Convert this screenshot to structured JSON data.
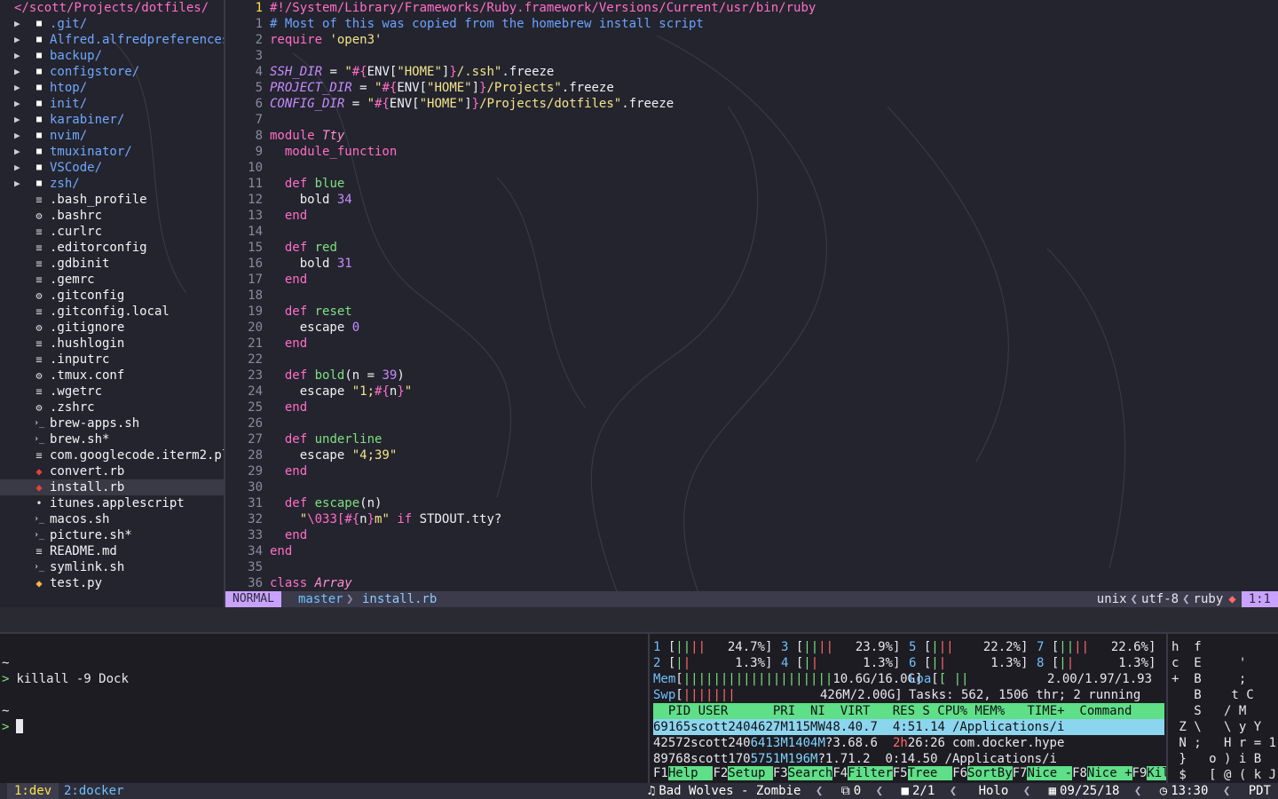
{
  "nerdtree": {
    "root": "</scott/Projects/dotfiles/",
    "items": [
      {
        "name": ".git/",
        "kind": "dir",
        "icon": "folder-icon"
      },
      {
        "name": "Alfred.alfredpreferences",
        "kind": "dir",
        "icon": "folder-icon"
      },
      {
        "name": "backup/",
        "kind": "dir",
        "icon": "folder-icon"
      },
      {
        "name": "configstore/",
        "kind": "dir",
        "icon": "folder-icon"
      },
      {
        "name": "htop/",
        "kind": "dir",
        "icon": "folder-icon"
      },
      {
        "name": "init/",
        "kind": "dir",
        "icon": "folder-icon"
      },
      {
        "name": "karabiner/",
        "kind": "dir",
        "icon": "folder-icon"
      },
      {
        "name": "nvim/",
        "kind": "dir",
        "icon": "folder-icon"
      },
      {
        "name": "tmuxinator/",
        "kind": "dir",
        "icon": "folder-icon"
      },
      {
        "name": "VSCode/",
        "kind": "dir",
        "icon": "folder-icon"
      },
      {
        "name": "zsh/",
        "kind": "dir",
        "icon": "folder-icon"
      },
      {
        "name": ".bash_profile",
        "kind": "file",
        "icon": "text-file-icon"
      },
      {
        "name": ".bashrc",
        "kind": "file",
        "icon": "gear-icon"
      },
      {
        "name": ".curlrc",
        "kind": "file",
        "icon": "text-file-icon"
      },
      {
        "name": ".editorconfig",
        "kind": "file",
        "icon": "text-file-icon"
      },
      {
        "name": ".gdbinit",
        "kind": "file",
        "icon": "text-file-icon"
      },
      {
        "name": ".gemrc",
        "kind": "file",
        "icon": "text-file-icon"
      },
      {
        "name": ".gitconfig",
        "kind": "file",
        "icon": "gear-icon"
      },
      {
        "name": ".gitconfig.local",
        "kind": "file",
        "icon": "text-file-icon"
      },
      {
        "name": ".gitignore",
        "kind": "file",
        "icon": "gear-icon"
      },
      {
        "name": ".hushlogin",
        "kind": "file",
        "icon": "text-file-icon"
      },
      {
        "name": ".inputrc",
        "kind": "file",
        "icon": "text-file-icon"
      },
      {
        "name": ".tmux.conf",
        "kind": "file",
        "icon": "gear-icon"
      },
      {
        "name": ".wgetrc",
        "kind": "file",
        "icon": "text-file-icon"
      },
      {
        "name": ".zshrc",
        "kind": "file",
        "icon": "gear-icon"
      },
      {
        "name": "brew-apps.sh",
        "kind": "file",
        "icon": "shell-icon"
      },
      {
        "name": "brew.sh*",
        "kind": "file",
        "icon": "shell-icon"
      },
      {
        "name": "com.googlecode.iterm2.pl",
        "kind": "file",
        "icon": "text-file-icon"
      },
      {
        "name": "convert.rb",
        "kind": "file",
        "icon": "ruby-icon"
      },
      {
        "name": "install.rb",
        "kind": "file",
        "icon": "ruby-icon",
        "selected": true
      },
      {
        "name": "itunes.applescript",
        "kind": "file",
        "icon": "apple-icon"
      },
      {
        "name": "macos.sh",
        "kind": "file",
        "icon": "shell-icon"
      },
      {
        "name": "picture.sh*",
        "kind": "file",
        "icon": "shell-icon"
      },
      {
        "name": "README.md",
        "kind": "file",
        "icon": "text-file-icon"
      },
      {
        "name": "symlink.sh",
        "kind": "file",
        "icon": "shell-icon"
      },
      {
        "name": "test.py",
        "kind": "file",
        "icon": "python-icon"
      }
    ]
  },
  "editor": {
    "current_line": "1",
    "lines": [
      {
        "n": "",
        "t": [
          [
            "sh",
            "#!/System/Library/Frameworks/Ruby.framework/Versions/Current/usr/bin/ruby"
          ]
        ]
      },
      {
        "n": "1",
        "t": [
          [
            "cm",
            "# Most of this was copied from the homebrew install script"
          ]
        ]
      },
      {
        "n": "2",
        "t": [
          [
            "kw",
            "require"
          ],
          [
            "id",
            " "
          ],
          [
            "str",
            "'open3'"
          ]
        ]
      },
      {
        "n": "3",
        "t": []
      },
      {
        "n": "4",
        "t": [
          [
            "cn",
            "SSH_DIR"
          ],
          [
            "id",
            " = "
          ],
          [
            "str",
            "\""
          ],
          [
            "int",
            "#{"
          ],
          [
            "id",
            "ENV["
          ],
          [
            "str",
            "\"HOME\""
          ],
          [
            "id",
            "]"
          ],
          [
            "int",
            "}"
          ],
          [
            "str",
            "/.ssh\""
          ],
          [
            "id",
            ".freeze"
          ]
        ]
      },
      {
        "n": "5",
        "t": [
          [
            "cn",
            "PROJECT_DIR"
          ],
          [
            "id",
            " = "
          ],
          [
            "str",
            "\""
          ],
          [
            "int",
            "#{"
          ],
          [
            "id",
            "ENV["
          ],
          [
            "str",
            "\"HOME\""
          ],
          [
            "id",
            "]"
          ],
          [
            "int",
            "}"
          ],
          [
            "str",
            "/Projects\""
          ],
          [
            "id",
            ".freeze"
          ]
        ]
      },
      {
        "n": "6",
        "t": [
          [
            "cn",
            "CONFIG_DIR"
          ],
          [
            "id",
            " = "
          ],
          [
            "str",
            "\""
          ],
          [
            "int",
            "#{"
          ],
          [
            "id",
            "ENV["
          ],
          [
            "str",
            "\"HOME\""
          ],
          [
            "id",
            "]"
          ],
          [
            "int",
            "}"
          ],
          [
            "str",
            "/Projects/dotfiles\""
          ],
          [
            "id",
            ".freeze"
          ]
        ]
      },
      {
        "n": "7",
        "t": []
      },
      {
        "n": "8",
        "t": [
          [
            "kw",
            "module"
          ],
          [
            "id",
            " "
          ],
          [
            "ty",
            "Tty"
          ]
        ]
      },
      {
        "n": "9",
        "t": [
          [
            "id",
            "  "
          ],
          [
            "kw",
            "module_function"
          ]
        ]
      },
      {
        "n": "10",
        "t": []
      },
      {
        "n": "11",
        "t": [
          [
            "id",
            "  "
          ],
          [
            "kw",
            "def"
          ],
          [
            "id",
            " "
          ],
          [
            "fn",
            "blue"
          ]
        ]
      },
      {
        "n": "12",
        "t": [
          [
            "id",
            "    bold "
          ],
          [
            "num",
            "34"
          ]
        ]
      },
      {
        "n": "13",
        "t": [
          [
            "id",
            "  "
          ],
          [
            "kw",
            "end"
          ]
        ]
      },
      {
        "n": "14",
        "t": []
      },
      {
        "n": "15",
        "t": [
          [
            "id",
            "  "
          ],
          [
            "kw",
            "def"
          ],
          [
            "id",
            " "
          ],
          [
            "fn",
            "red"
          ]
        ]
      },
      {
        "n": "16",
        "t": [
          [
            "id",
            "    bold "
          ],
          [
            "num",
            "31"
          ]
        ]
      },
      {
        "n": "17",
        "t": [
          [
            "id",
            "  "
          ],
          [
            "kw",
            "end"
          ]
        ]
      },
      {
        "n": "18",
        "t": []
      },
      {
        "n": "19",
        "t": [
          [
            "id",
            "  "
          ],
          [
            "kw",
            "def"
          ],
          [
            "id",
            " "
          ],
          [
            "fn",
            "reset"
          ]
        ]
      },
      {
        "n": "20",
        "t": [
          [
            "id",
            "    escape "
          ],
          [
            "num",
            "0"
          ]
        ]
      },
      {
        "n": "21",
        "t": [
          [
            "id",
            "  "
          ],
          [
            "kw",
            "end"
          ]
        ]
      },
      {
        "n": "22",
        "t": []
      },
      {
        "n": "23",
        "t": [
          [
            "id",
            "  "
          ],
          [
            "kw",
            "def"
          ],
          [
            "id",
            " "
          ],
          [
            "fn",
            "bold"
          ],
          [
            "id",
            "(n = "
          ],
          [
            "num",
            "39"
          ],
          [
            "id",
            ")"
          ]
        ]
      },
      {
        "n": "24",
        "t": [
          [
            "id",
            "    escape "
          ],
          [
            "str",
            "\"1;"
          ],
          [
            "int",
            "#{"
          ],
          [
            "id",
            "n"
          ],
          [
            "int",
            "}"
          ],
          [
            "str",
            "\""
          ]
        ]
      },
      {
        "n": "25",
        "t": [
          [
            "id",
            "  "
          ],
          [
            "kw",
            "end"
          ]
        ]
      },
      {
        "n": "26",
        "t": []
      },
      {
        "n": "27",
        "t": [
          [
            "id",
            "  "
          ],
          [
            "kw",
            "def"
          ],
          [
            "id",
            " "
          ],
          [
            "fn",
            "underline"
          ]
        ]
      },
      {
        "n": "28",
        "t": [
          [
            "id",
            "    escape "
          ],
          [
            "str",
            "\"4;39\""
          ]
        ]
      },
      {
        "n": "29",
        "t": [
          [
            "id",
            "  "
          ],
          [
            "kw",
            "end"
          ]
        ]
      },
      {
        "n": "30",
        "t": []
      },
      {
        "n": "31",
        "t": [
          [
            "id",
            "  "
          ],
          [
            "kw",
            "def"
          ],
          [
            "id",
            " "
          ],
          [
            "fn",
            "escape"
          ],
          [
            "id",
            "(n)"
          ]
        ]
      },
      {
        "n": "32",
        "t": [
          [
            "id",
            "    "
          ],
          [
            "str",
            "\""
          ],
          [
            "int",
            "\\033["
          ],
          [
            "int",
            "#{"
          ],
          [
            "id",
            "n"
          ],
          [
            "int",
            "}"
          ],
          [
            "str",
            "m\""
          ],
          [
            "id",
            " "
          ],
          [
            "kw",
            "if"
          ],
          [
            "id",
            " STDOUT.tty?"
          ]
        ]
      },
      {
        "n": "33",
        "t": [
          [
            "id",
            "  "
          ],
          [
            "kw",
            "end"
          ]
        ]
      },
      {
        "n": "34",
        "t": [
          [
            "kw",
            "end"
          ]
        ]
      },
      {
        "n": "35",
        "t": []
      },
      {
        "n": "36",
        "t": [
          [
            "kw",
            "class"
          ],
          [
            "id",
            " "
          ],
          [
            "ty",
            "Array"
          ]
        ]
      }
    ]
  },
  "statusline": {
    "mode": "NORMAL",
    "branch": "master",
    "file": "install.rb",
    "fileformat": "unix",
    "encoding": "utf-8",
    "filetype": "ruby",
    "position": "1:1"
  },
  "shell": {
    "lines": [
      {
        "prompt": "~",
        "cmd": ""
      },
      {
        "prompt": ">",
        "cmd": "killall -9 Dock"
      },
      {
        "prompt": "~",
        "cmd": ""
      },
      {
        "prompt": ">",
        "cmd": ""
      }
    ]
  },
  "htop": {
    "cpus": [
      {
        "id": "1",
        "bar": "||",
        "bar_r": "||",
        "pct": "24.7%"
      },
      {
        "id": "3",
        "bar": "||",
        "bar_r": "||",
        "pct": "23.9%"
      },
      {
        "id": "5",
        "bar": "|",
        "bar_r": "||",
        "pct": "22.2%"
      },
      {
        "id": "7",
        "bar": "||",
        "bar_r": "||",
        "pct": "22.6%"
      },
      {
        "id": "2",
        "bar": "|",
        "bar_r": "|",
        "pct": "1.3%"
      },
      {
        "id": "4",
        "bar": "|",
        "bar_r": "|",
        "pct": "1.3%"
      },
      {
        "id": "6",
        "bar": "|",
        "bar_r": "|",
        "pct": "1.3%"
      },
      {
        "id": "8",
        "bar": "|",
        "bar_r": "|",
        "pct": "1.3%"
      }
    ],
    "mem_bar": "||||||||||||||||||||",
    "mem": "10.6G/16.0G",
    "swp_bar": "|||||||",
    "swp": "426M/2.00G",
    "load_label": "Loa",
    "load": "2.00/1.97/1.93",
    "tasks": "Tasks: 562, 1506 thr; 2 running",
    "header": "  PID USER      PRI  NI  VIRT   RES S CPU% MEM%   TIME+  Command",
    "processes": [
      {
        "pid": "69165",
        "user": "scott",
        "pri": "24",
        "ni": "0",
        "virt": "4627M",
        "res": "115M",
        "s": "W",
        "cpu": "48.4",
        "mem": "0.7",
        "time": "4:51.14",
        "cmd": "/Applications/i"
      },
      {
        "pid": "42572",
        "user": "scott",
        "pri": "24",
        "ni": "0",
        "virt": "6413M",
        "res": "1404M",
        "s": "?",
        "cpu": "3.6",
        "mem": "8.6",
        "time_h": "2h",
        "time": "26:26",
        "cmd": "com.docker.hype"
      },
      {
        "pid": "89768",
        "user": "scott",
        "pri": "17",
        "ni": "0",
        "virt": "5751M",
        "res": "196M",
        "s": "?",
        "cpu": "1.7",
        "mem": "1.2",
        "time": "0:14.50",
        "cmd": "/Applications/i"
      }
    ],
    "fkeys": [
      {
        "k": "F1",
        "l": "Help  "
      },
      {
        "k": "F2",
        "l": "Setup "
      },
      {
        "k": "F3",
        "l": "Search"
      },
      {
        "k": "F4",
        "l": "Filter"
      },
      {
        "k": "F5",
        "l": "Tree  "
      },
      {
        "k": "F6",
        "l": "SortBy"
      },
      {
        "k": "F7",
        "l": "Nice -"
      },
      {
        "k": "F8",
        "l": "Nice +"
      },
      {
        "k": "F9",
        "l": "Kill  "
      }
    ]
  },
  "matrix": {
    "rows": [
      "h  f",
      "c  E     '",
      "+  B     ;",
      "   B    t C",
      "   S   / M",
      " Z \\   \\ y Y",
      " N ;   H r = 1",
      " }   o ) i B",
      " $   [ @ ( k J"
    ]
  },
  "tmux": {
    "windows": [
      "1:dev",
      "2:docker"
    ],
    "now_playing": "Bad Wolves - Zombie",
    "sessions": "0",
    "panes": "2/1",
    "hostname": "Holo",
    "date": "09/25/18",
    "time": "13:30",
    "tz": "PDT"
  }
}
